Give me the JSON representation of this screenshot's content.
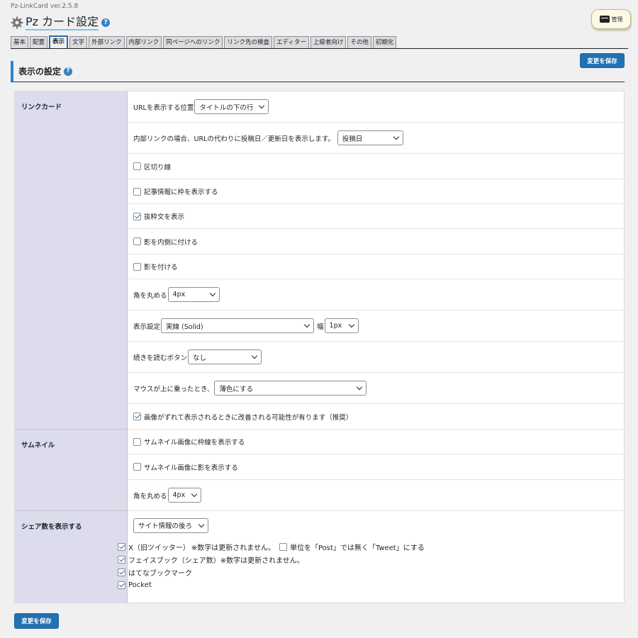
{
  "app": {
    "version": "Pz-LinkCard ver.2.5.8",
    "title": "Pz カード設定",
    "help_glyph": "?",
    "admin_label": "管理"
  },
  "tabs": [
    {
      "label": "基本"
    },
    {
      "label": "配置"
    },
    {
      "label": "表示",
      "active": true
    },
    {
      "label": "文字"
    },
    {
      "label": "外部リンク"
    },
    {
      "label": "内部リンク"
    },
    {
      "label": "同ページへのリンク"
    },
    {
      "label": "リンク先の検査"
    },
    {
      "label": "エディター"
    },
    {
      "label": "上級者向け"
    },
    {
      "label": "その他"
    },
    {
      "label": "初期化"
    }
  ],
  "save_label": "変更を保存",
  "section_title": "表示の設定",
  "linkcard": {
    "heading": "リンクカード",
    "url_position_label": "URLを表示する位置",
    "url_position_value": "タイトルの下の行",
    "internal_date_label": "内部リンクの場合、URLの代わりに投稿日／更新日を表示します。",
    "internal_date_value": "投稿日",
    "divider_label": "区切り線",
    "divider_checked": false,
    "frame_label": "記事情報に枠を表示する",
    "frame_checked": false,
    "excerpt_label": "抜粋文を表示",
    "excerpt_checked": true,
    "inner_shadow_label": "影を内側に付ける",
    "inner_shadow_checked": false,
    "shadow_label": "影を付ける",
    "shadow_checked": false,
    "radius_label": "角を丸める",
    "radius_value": "4px",
    "border_label": "表示設定",
    "border_style_value": "実線 (Solid)",
    "width_label": "幅",
    "width_value": "1px",
    "more_button_label": "続きを読むボタン",
    "more_button_value": "なし",
    "hover_label": "マウスが上に乗ったとき、",
    "hover_value": "薄色にする",
    "image_fix_label": "画像がずれて表示されるときに改善される可能性が有ります（推奨）",
    "image_fix_checked": true
  },
  "thumbnail": {
    "heading": "サムネイル",
    "border_label": "サムネイル画像に枠線を表示する",
    "border_checked": false,
    "shadow_label": "サムネイル画像に影を表示する",
    "shadow_checked": false,
    "radius_label": "角を丸める",
    "radius_value": "4px"
  },
  "share": {
    "heading": "シェア数を表示する",
    "position_value": "サイト情報の後ろ",
    "x_label": "X（旧ツイッター）",
    "x_note": "※数字は更新されません。",
    "x_checked": true,
    "tweet_unit_label": "単位を「Post」では無く「Tweet」にする",
    "tweet_unit_checked": false,
    "facebook_label": "フェイスブック（シェア数）",
    "facebook_note": "※数字は更新されません。",
    "facebook_checked": true,
    "hatena_label": "はてなブックマーク",
    "hatena_checked": true,
    "pocket_label": "Pocket",
    "pocket_checked": true
  }
}
